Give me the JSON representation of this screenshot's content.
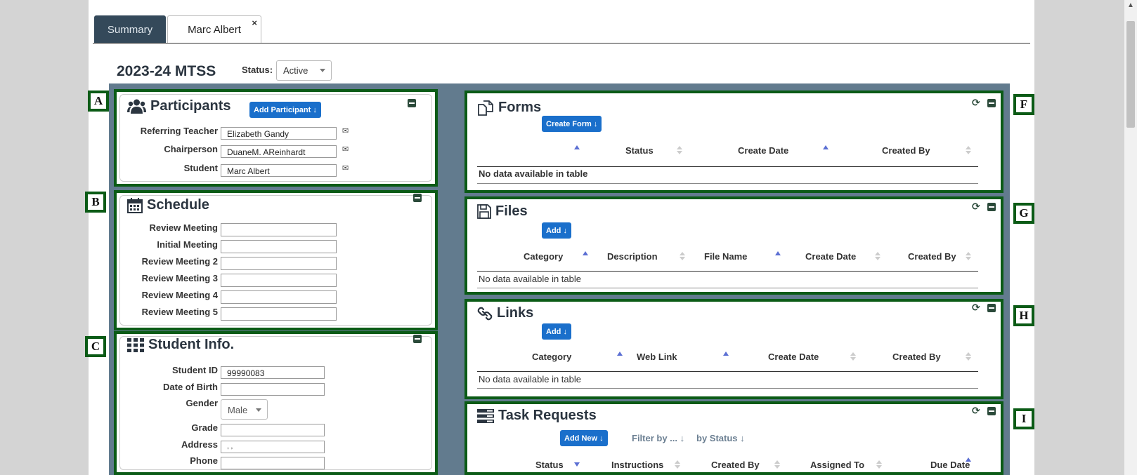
{
  "tabs": {
    "summary": "Summary",
    "student": "Marc Albert",
    "close": "×"
  },
  "plan": {
    "title": "2023-24 MTSS",
    "status_label": "Status:",
    "status_value": "Active"
  },
  "callouts": [
    "A",
    "B",
    "C",
    "F",
    "G",
    "H",
    "I"
  ],
  "participants": {
    "title": "Participants",
    "add_button": "Add Participant ↓",
    "fields": [
      {
        "label": "Referring Teacher",
        "value": "Elizabeth Gandy"
      },
      {
        "label": "Chairperson",
        "value": "DuaneM. AReinhardt"
      },
      {
        "label": "Student",
        "value": "Marc Albert"
      }
    ]
  },
  "schedule": {
    "title": "Schedule",
    "fields": [
      {
        "label": "Review Meeting",
        "value": ""
      },
      {
        "label": "Initial Meeting",
        "value": ""
      },
      {
        "label": "Review Meeting 2",
        "value": ""
      },
      {
        "label": "Review Meeting 3",
        "value": ""
      },
      {
        "label": "Review Meeting 4",
        "value": ""
      },
      {
        "label": "Review Meeting 5",
        "value": ""
      }
    ]
  },
  "student_info": {
    "title": "Student Info.",
    "fields": [
      {
        "label": "Student ID",
        "value": "99990083"
      },
      {
        "label": "Date of Birth",
        "value": ""
      },
      {
        "label": "Gender",
        "value": "Male"
      },
      {
        "label": "Grade",
        "value": ""
      },
      {
        "label": "Address",
        "value": ", ,"
      },
      {
        "label": "Phone",
        "value": ""
      }
    ]
  },
  "forms": {
    "title": "Forms",
    "create_button": "Create Form ↓",
    "columns": [
      "Status",
      "Create Date",
      "Created By"
    ],
    "empty": "No data available in table"
  },
  "files": {
    "title": "Files",
    "add_button": "Add  ↓",
    "columns": [
      "Category",
      "Description",
      "File Name",
      "Create Date",
      "Created By"
    ],
    "empty": "No data available in table"
  },
  "links": {
    "title": "Links",
    "add_button": "Add  ↓",
    "columns": [
      "Category",
      "Web Link",
      "Create Date",
      "Created By"
    ],
    "empty": "No data available in table"
  },
  "tasks": {
    "title": "Task Requests",
    "add_button": "Add New ↓",
    "filter_by": "Filter by ...  ↓",
    "by_status": "by Status  ↓",
    "columns": [
      "Status",
      "Instructions",
      "Created By",
      "Assigned To",
      "Due Date"
    ]
  },
  "colors": {
    "panel_border": "#0b5b16",
    "workspace": "#627b8e",
    "button": "#1a6fcb",
    "tab_active_bg": "#34495a"
  }
}
